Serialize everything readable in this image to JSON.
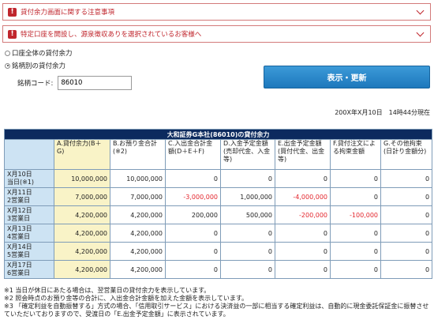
{
  "notices": [
    {
      "text": "貸付余力画面に関する注意事項"
    },
    {
      "text": "特定口座を開設し、源泉徴収ありを選択されているお客様へ"
    }
  ],
  "options": {
    "all_account": "口座全体の貸付余力",
    "by_stock": "銘柄別の貸付余力",
    "selected": "by_stock"
  },
  "code": {
    "label": "銘柄コード:",
    "value": "86010"
  },
  "submit_label": "表示・更新",
  "timestamp": "200X年X月10日　14時44分現在",
  "table": {
    "title": "大和証券G本社(86010)の貸付余力",
    "headers": [
      "A.貸付余力(B＋G)",
      "B.お預り金合計(※2)",
      "C.入出金合計金額(D＋E＋F)",
      "D.入金予定金額(売却代金、入金等)",
      "E.出金予定金額(買付代金、出金等)",
      "F.貸付注文による拘束金額",
      "G.その他拘束(日計り金額分)"
    ],
    "rows": [
      {
        "d1": "X月10日",
        "d2": "当日(※1)",
        "values": [
          "10,000,000",
          "10,000,000",
          "0",
          "0",
          "0",
          "0",
          "0"
        ]
      },
      {
        "d1": "X月11日",
        "d2": "2営業日",
        "values": [
          "7,000,000",
          "7,000,000",
          "-3,000,000",
          "1,000,000",
          "-4,000,000",
          "0",
          "0"
        ]
      },
      {
        "d1": "X月12日",
        "d2": "3営業日",
        "values": [
          "4,200,000",
          "4,200,000",
          "200,000",
          "500,000",
          "-200,000",
          "-100,000",
          "0"
        ]
      },
      {
        "d1": "X月13日",
        "d2": "4営業日",
        "values": [
          "4,200,000",
          "4,200,000",
          "0",
          "0",
          "0",
          "0",
          "0"
        ]
      },
      {
        "d1": "X月14日",
        "d2": "5営業日",
        "values": [
          "4,200,000",
          "4,200,000",
          "0",
          "0",
          "0",
          "0",
          "0"
        ]
      },
      {
        "d1": "X月17日",
        "d2": "6営業日",
        "values": [
          "4,200,000",
          "4,200,000",
          "0",
          "0",
          "0",
          "0",
          "0"
        ]
      }
    ]
  },
  "notes": [
    "※1 当日が休日にあたる場合は、翌営業日の貸付余力を表示しています。",
    "※2 照会時点のお預り金等の合計に、入出金合計金額を加えた金額を表示しています。",
    "※3 「確定利益を自動振替する」方式の場合、「信用取引サービス」における決済益の一部に相当する確定利益は、自動的に現金委託保証金に振替させていただいておりますので、受渡日の「E.出金予定金額」に表示されています。"
  ],
  "colors": {
    "negative": "#e3252c",
    "header": "#0c2a5e",
    "highlight": "#f9f3c7",
    "label_bg": "#cde3f3",
    "button": "#1d78bc"
  }
}
